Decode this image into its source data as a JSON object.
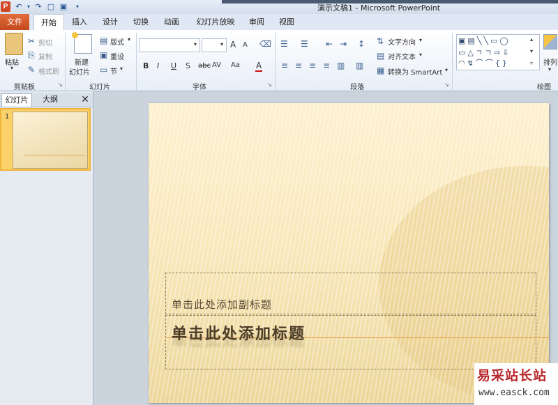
{
  "window": {
    "title": "演示文稿1 - Microsoft PowerPoint",
    "app_icon": "P"
  },
  "quick_access": {
    "icons": [
      "undo-icon",
      "redo-icon",
      "new-icon",
      "save-icon"
    ]
  },
  "tabs": [
    "文件",
    "开始",
    "插入",
    "设计",
    "切换",
    "动画",
    "幻灯片放映",
    "审阅",
    "视图"
  ],
  "ribbon": {
    "clipboard": {
      "paste": "粘贴",
      "cut": "剪切",
      "copy": "复制",
      "format_painter": "格式刷",
      "label": "剪贴板"
    },
    "slides": {
      "new_slide_1": "新建",
      "new_slide_2": "幻灯片",
      "layout": "版式",
      "reset": "重设",
      "section": "节",
      "label": "幻灯片"
    },
    "font": {
      "label": "字体",
      "grow": "A",
      "shrink": "A",
      "bold": "B",
      "italic": "I",
      "underline": "U",
      "shadow": "S",
      "strike": "abc",
      "spacing": "AV",
      "case": "Aa",
      "color": "A"
    },
    "paragraph": {
      "label": "段落",
      "text_direction": "文字方向",
      "align_text": "对齐文本",
      "smartart": "转换为 SmartArt"
    },
    "drawing": {
      "label": "绘图",
      "arrange": "排列"
    }
  },
  "left_pane": {
    "tab_slides": "幻灯片",
    "tab_outline": "大纲",
    "close": "✕",
    "slide_number": "1"
  },
  "slide": {
    "subtitle_placeholder": "单击此处添加副标题",
    "title_placeholder": "单击此处添加标题"
  },
  "watermark": {
    "text": "易采站长站",
    "url": "www.easck.com"
  }
}
